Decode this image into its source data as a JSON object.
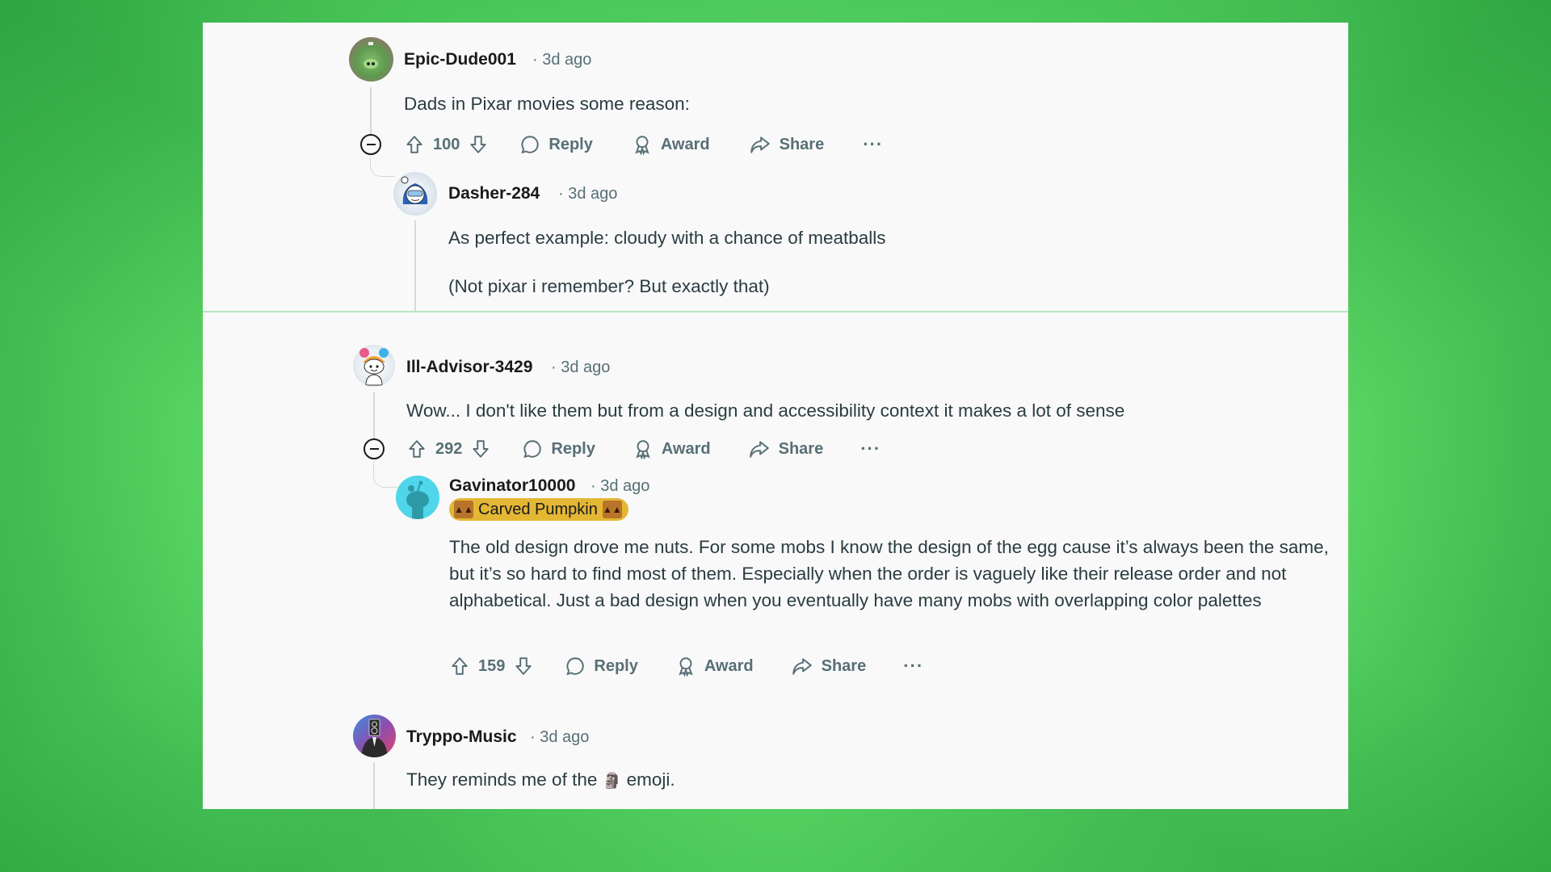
{
  "comments": [
    {
      "author": "Epic-Dude001",
      "time": "· 3d ago",
      "body": "Dads in Pixar movies some reason:",
      "votes": "100",
      "avatar": "green-pig-avatar",
      "replies": [
        {
          "author": "Dasher-284",
          "time": "· 3d ago",
          "paragraphs": [
            "As perfect example: cloudy with a chance of meatballs",
            "(Not pixar i remember? But exactly that)"
          ],
          "avatar": "snow-goggles-avatar"
        }
      ]
    },
    {
      "author": "Ill-Advisor-3429",
      "time": "· 3d ago",
      "body": "Wow... I don't like them but from a design and accessibility context it makes a lot of sense",
      "votes": "292",
      "avatar": "rainbow-hair-snoo-avatar",
      "replies": [
        {
          "author": "Gavinator10000",
          "time": "· 3d ago",
          "flair": "Carved Pumpkin",
          "body": "The old design drove me nuts. For some mobs I know the design of the egg cause it’s always been the same, but it’s so hard to find most of them. Especially when the order is vaguely like their release order and not alphabetical. Just a bad design when you eventually have many mobs with overlapping color palettes",
          "votes": "159",
          "avatar": "default-snoo-avatar"
        }
      ]
    },
    {
      "author": "Tryppo-Music",
      "time": "· 3d ago",
      "body_before": "They reminds me of the",
      "emoji": "🗿",
      "body_after": "emoji.",
      "avatar": "speaker-head-avatar"
    }
  ],
  "actions": {
    "reply": "Reply",
    "award": "Award",
    "share": "Share",
    "more": "···"
  },
  "colors": {
    "background_green": "#62e06a",
    "panel": "#f9f9f9",
    "text": "#1a1a1b",
    "meta": "#576f76",
    "flair": "#e3b734"
  }
}
